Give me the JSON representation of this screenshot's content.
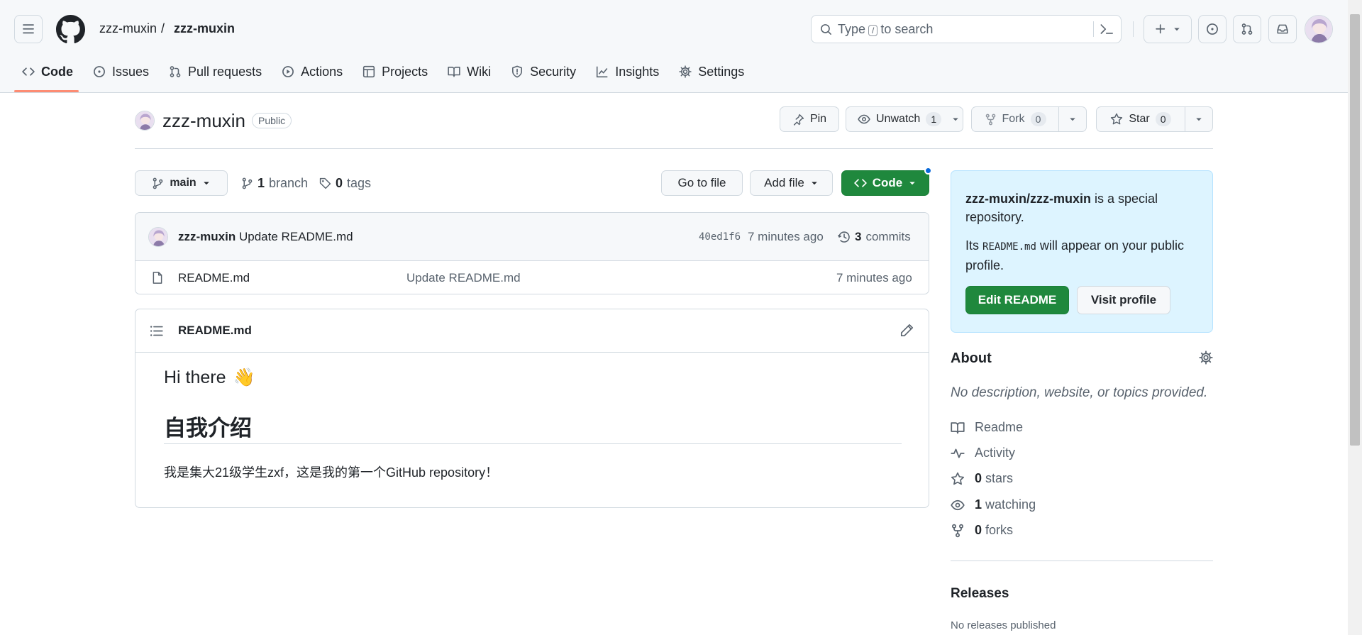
{
  "header": {
    "owner": "zzz-muxin",
    "separator": "/",
    "repo": "zzz-muxin",
    "search": {
      "before": "Type",
      "key": "/",
      "after": "to search"
    }
  },
  "tabs": [
    {
      "label": "Code",
      "icon": "code-icon"
    },
    {
      "label": "Issues",
      "icon": "issue-icon"
    },
    {
      "label": "Pull requests",
      "icon": "pull-request-icon"
    },
    {
      "label": "Actions",
      "icon": "play-icon"
    },
    {
      "label": "Projects",
      "icon": "table-icon"
    },
    {
      "label": "Wiki",
      "icon": "book-icon"
    },
    {
      "label": "Security",
      "icon": "shield-icon"
    },
    {
      "label": "Insights",
      "icon": "graph-icon"
    },
    {
      "label": "Settings",
      "icon": "gear-icon"
    }
  ],
  "repo_head": {
    "title": "zzz-muxin",
    "visibility": "Public",
    "pin": "Pin",
    "unwatch": "Unwatch",
    "watch_count": "1",
    "fork": "Fork",
    "fork_count": "0",
    "star": "Star",
    "star_count": "0"
  },
  "toolbar": {
    "branch": "main",
    "branch_count": "1",
    "branch_label": "branch",
    "tag_count": "0",
    "tag_label": "tags",
    "go_to_file": "Go to file",
    "add_file": "Add file",
    "code": "Code"
  },
  "commit": {
    "author": "zzz-muxin",
    "message": "Update README.md",
    "sha": "40ed1f6",
    "time": "7 minutes ago",
    "commits_count": "3",
    "commits_label": "commits"
  },
  "files": [
    {
      "name": "README.md",
      "message": "Update README.md",
      "time": "7 minutes ago"
    }
  ],
  "readme": {
    "filename": "README.md",
    "h1": "Hi there",
    "h1_emoji": "👋",
    "h2": "自我介绍",
    "p": "我是集大21级学生zxf，这是我的第一个GitHub repository！"
  },
  "special": {
    "repo_path": "zzz-muxin/zzz-muxin",
    "line1_rest": " is a special repository.",
    "its": "Its ",
    "file": "README.md",
    "line2_rest": " will appear on your public profile.",
    "edit": "Edit README",
    "visit": "Visit profile"
  },
  "about": {
    "title": "About",
    "description": "No description, website, or topics provided.",
    "readme": "Readme",
    "activity": "Activity",
    "stars_count": "0",
    "stars_label": "stars",
    "watching_count": "1",
    "watching_label": "watching",
    "forks_count": "0",
    "forks_label": "forks"
  },
  "releases": {
    "title": "Releases",
    "empty": "No releases published"
  },
  "colors": {
    "primary_green": "#1f883d",
    "underline": "#fd8c73",
    "special_bg": "#ddf4ff",
    "notification_dot": "#0969da"
  }
}
